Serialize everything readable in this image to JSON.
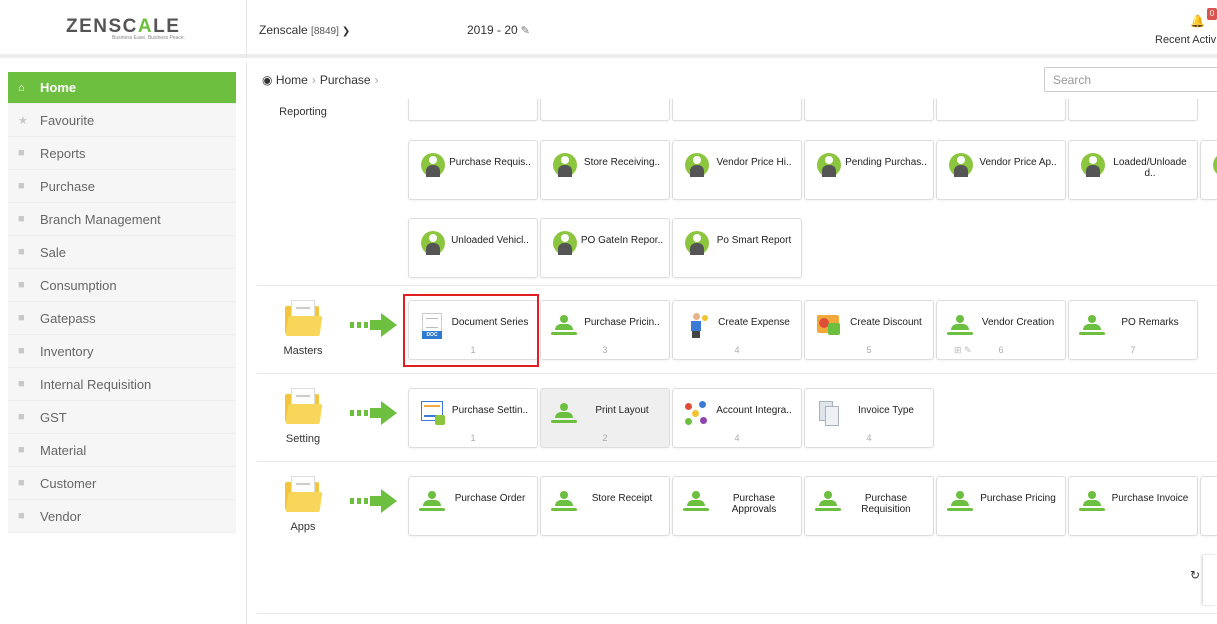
{
  "app": {
    "logo_left": "ZENSC",
    "logo_accent": "A",
    "logo_right": "LE",
    "tagline": "Business Ease. Business Peace.",
    "company_name": "Zenscale",
    "company_code": "[8849]",
    "financial_year": "2019 - 20",
    "notification_count": "0",
    "recent_label": "Recent Activ"
  },
  "sidebar": {
    "items": [
      {
        "label": "Home",
        "icon": "home-icon",
        "active": true
      },
      {
        "label": "Favourite",
        "icon": "star-icon"
      },
      {
        "label": "Reports",
        "icon": "file-icon"
      },
      {
        "label": "Purchase",
        "icon": "folder-icon"
      },
      {
        "label": "Branch Management",
        "icon": "folder-icon"
      },
      {
        "label": "Sale",
        "icon": "folder-icon"
      },
      {
        "label": "Consumption",
        "icon": "folder-icon"
      },
      {
        "label": "Gatepass",
        "icon": "folder-icon"
      },
      {
        "label": "Inventory",
        "icon": "folder-icon"
      },
      {
        "label": "Internal Requisition",
        "icon": "folder-icon"
      },
      {
        "label": "GST",
        "icon": "folder-icon"
      },
      {
        "label": "Material",
        "icon": "folder-icon"
      },
      {
        "label": "Customer",
        "icon": "folder-icon"
      },
      {
        "label": "Vendor",
        "icon": "folder-icon"
      }
    ]
  },
  "breadcrumb": {
    "home": "Home",
    "current": "Purchase"
  },
  "search": {
    "placeholder": "Search"
  },
  "sections": {
    "reporting": {
      "label": "Reporting",
      "row1": [
        {
          "name": "Purchase Requis..",
          "icon": "report-person-icon"
        },
        {
          "name": "Store Receiving..",
          "icon": "report-person-icon"
        },
        {
          "name": "Vendor Price Hi..",
          "icon": "report-person-icon"
        },
        {
          "name": "Pending Purchas..",
          "icon": "report-person-icon"
        },
        {
          "name": "Vendor Price Ap..",
          "icon": "report-person-icon"
        },
        {
          "name": "Loaded/Unloade d..",
          "icon": "report-person-icon"
        }
      ],
      "row2": [
        {
          "name": "Unloaded Vehicl..",
          "icon": "report-person-icon"
        },
        {
          "name": "PO GateIn Repor..",
          "icon": "report-person-icon"
        },
        {
          "name": "Po Smart Report",
          "icon": "report-person-icon"
        }
      ]
    },
    "masters": {
      "label": "Masters",
      "tiles": [
        {
          "name": "Document Series",
          "count": "1",
          "icon": "document-icon"
        },
        {
          "name": "Purchase Pricin..",
          "count": "3",
          "icon": "green-user-icon"
        },
        {
          "name": "Create Expense",
          "count": "4",
          "icon": "expense-icon"
        },
        {
          "name": "Create Discount",
          "count": "5",
          "icon": "discount-icon"
        },
        {
          "name": "Vendor Creation",
          "count": "6",
          "icon": "green-user-icon"
        },
        {
          "name": "PO Remarks",
          "count": "7",
          "icon": "green-user-icon"
        }
      ],
      "doc_label": "DOC"
    },
    "setting": {
      "label": "Setting",
      "tiles": [
        {
          "name": "Purchase Settin..",
          "count": "1",
          "icon": "settings-doc-icon"
        },
        {
          "name": "Print Layout",
          "count": "2",
          "icon": "green-user-icon"
        },
        {
          "name": "Account Integra..",
          "count": "4",
          "icon": "integration-icon"
        },
        {
          "name": "Invoice Type",
          "count": "4",
          "icon": "invoice-icon"
        }
      ]
    },
    "apps": {
      "label": "Apps",
      "tiles": [
        {
          "name": "Purchase Order",
          "icon": "green-user-icon"
        },
        {
          "name": "Store Receipt",
          "icon": "green-user-icon"
        },
        {
          "name": "Purchase Approvals",
          "icon": "green-user-icon"
        },
        {
          "name": "Purchase Requisition",
          "icon": "green-user-icon"
        },
        {
          "name": "Purchase Pricing",
          "icon": "green-user-icon"
        },
        {
          "name": "Purchase Invoice",
          "icon": "green-user-icon"
        }
      ]
    }
  },
  "colors": {
    "accent": "#6cbf3f",
    "highlight": "#e02020",
    "badge": "#d9534f"
  }
}
